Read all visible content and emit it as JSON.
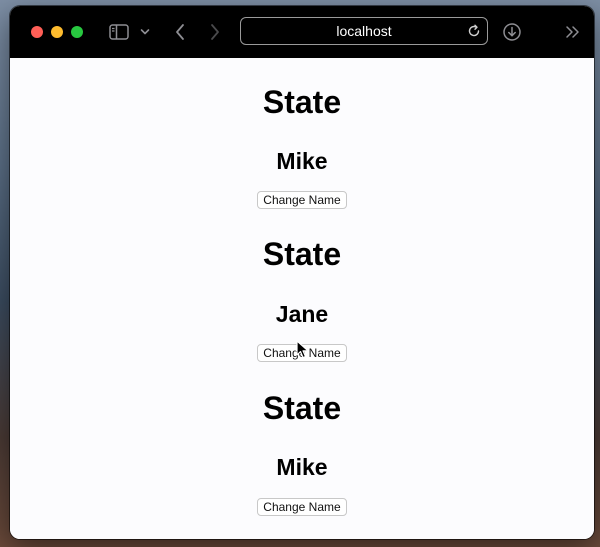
{
  "browser": {
    "address": "localhost",
    "icons": {
      "sidebar": "sidebar-icon",
      "sidebar_menu": "chevron-down-icon",
      "back": "chevron-left-icon",
      "forward": "chevron-right-icon",
      "reload": "reload-icon",
      "download": "download-icon",
      "more": "double-chevron-right-icon"
    },
    "traffic_light_colors": {
      "close": "#ff5f57",
      "minimize": "#febc2e",
      "maximize": "#28c840"
    }
  },
  "sections": [
    {
      "title": "State",
      "name": "Mike",
      "button_label": "Change Name"
    },
    {
      "title": "State",
      "name": "Jane",
      "button_label": "Change Name"
    },
    {
      "title": "State",
      "name": "Mike",
      "button_label": "Change Name"
    }
  ]
}
